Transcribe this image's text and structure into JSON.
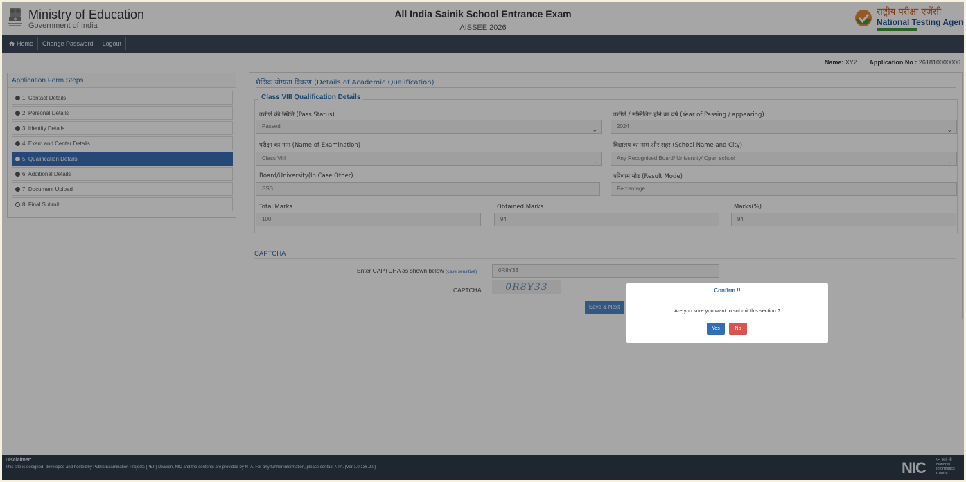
{
  "header": {
    "ministry_title": "Ministry of Education",
    "ministry_subtitle": "Government of India",
    "exam_title": "All India Sainik School Entrance Exam",
    "exam_subtitle": "AISSEE 2026",
    "agency_hindi": "राष्ट्रीय परीक्षा एजेंसी",
    "agency_english": "National Testing Agency"
  },
  "nav": {
    "home": "Home",
    "change_password": "Change Password",
    "logout": "Logout"
  },
  "user": {
    "name_label": "Name:",
    "name_value": "XYZ",
    "app_label": "Application No :",
    "app_value": "261810000006"
  },
  "sidebar": {
    "title": "Application Form Steps",
    "steps": [
      {
        "label": "1. Contact Details"
      },
      {
        "label": "2. Personal Details"
      },
      {
        "label": "3. Identity Details"
      },
      {
        "label": "4. Exam and Center Details"
      },
      {
        "label": "5. Qualification Details"
      },
      {
        "label": "6. Additional Details"
      },
      {
        "label": "7. Document Upload"
      },
      {
        "label": "8. Final Submit"
      }
    ],
    "active_index": 4
  },
  "form": {
    "section_title": "शैक्षिक योग्यता विवरण (Details of Academic Qualification)",
    "fieldset_title": "Class VIII Qualification Details",
    "pass_status_label": "उत्तीर्ण की स्थिति (Pass Status)",
    "pass_status_value": "Passed",
    "year_label": "उत्तीर्ण / सम्मिलित होने का वर्ष (Year of Passing / appearing)",
    "year_value": "2024",
    "exam_name_label": "परीक्षा का नाम (Name of Examination)",
    "exam_name_value": "Class VIII",
    "school_label": "विद्यालय का नाम और शहर (School Name and City)",
    "school_value": "Any Recognised Board/ University/ Open school",
    "board_label": "Board/University(In Case Other)",
    "board_value": "SSS",
    "result_mode_label": "परिणाम मोड (Result Mode)",
    "result_mode_value": "Percentage",
    "total_marks_label": "Total Marks",
    "total_marks_value": "100",
    "obtained_marks_label": "Obtained Marks",
    "obtained_marks_value": "94",
    "percent_label": "Marks(%)",
    "percent_value": "94"
  },
  "captcha": {
    "title": "CAPTCHA",
    "enter_label": "Enter CAPTCHA as shown below",
    "case_note": "(case sensitive)",
    "input_value": "0R8Y33",
    "captcha_label": "CAPTCHA",
    "captcha_image_text": "0R8Y33",
    "save_button": "Save & Next"
  },
  "modal": {
    "title": "Confirm !!",
    "message": "Are you sure you want to submit this section ?",
    "yes": "Yes",
    "no": "No"
  },
  "footer": {
    "disclaimer_title": "Disclaimer:",
    "disclaimer_text": "This site is designed, developed and hosted by Public Examination Projects (PEP) Division, NIC and the contents are provided by NTA. For any further information, please contact NTA. (Ver 1.0.136.2.0)",
    "nic_big": "NIC",
    "nic_line1": "एन आई सी",
    "nic_line2": "National",
    "nic_line3": "Informatics",
    "nic_line4": "Centre"
  },
  "colors": {
    "nav_bg": "#3c4a5a",
    "accent": "#3b6fb6",
    "danger": "#d9534f"
  }
}
